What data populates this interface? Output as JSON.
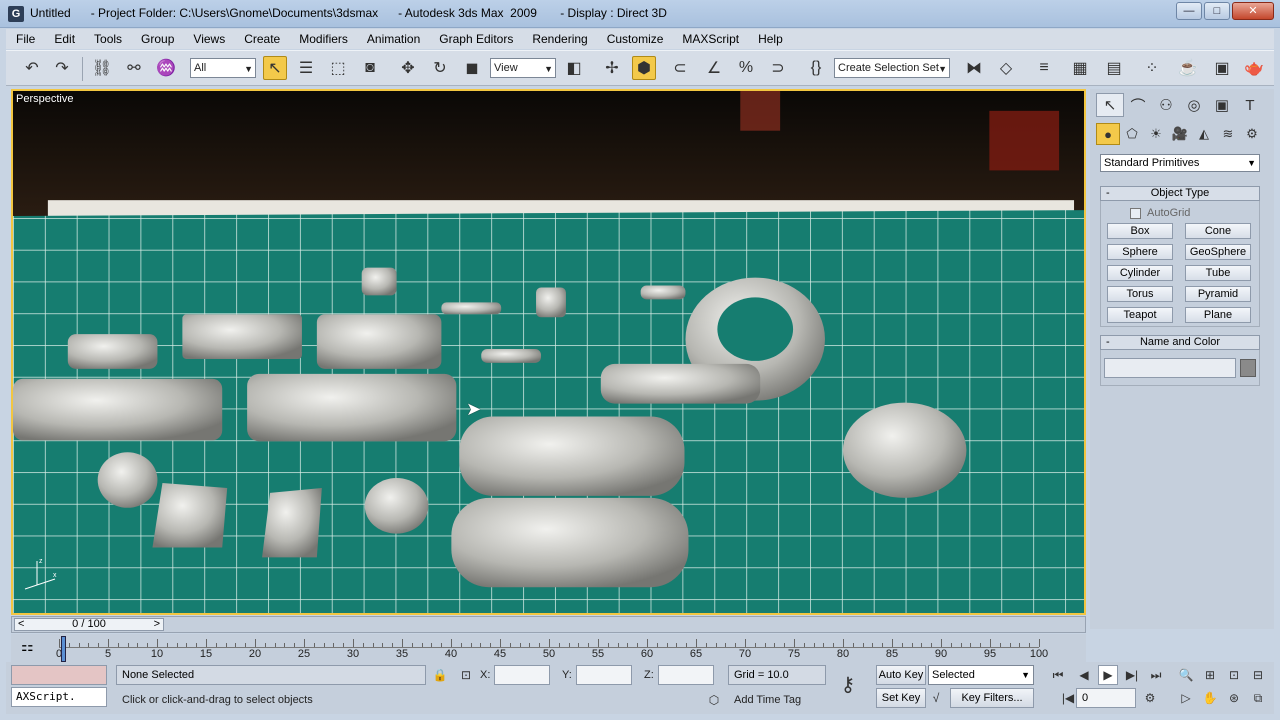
{
  "window": {
    "title": "Untitled      - Project Folder: C:\\Users\\Gnome\\Documents\\3dsmax      - Autodesk 3ds Max  2009       - Display : Direct 3D",
    "minimize": "—",
    "maximize": "□",
    "close": "✕"
  },
  "menu": [
    "File",
    "Edit",
    "Tools",
    "Group",
    "Views",
    "Create",
    "Modifiers",
    "Animation",
    "Graph Editors",
    "Rendering",
    "Customize",
    "MAXScript",
    "Help"
  ],
  "toolbar": {
    "selection_filter": "All",
    "reference_coord": "View",
    "named_selection": "Create Selection Set"
  },
  "viewport": {
    "label": "Perspective"
  },
  "command_panel": {
    "category": "Standard Primitives",
    "object_type_title": "Object Type",
    "autogrid_label": "AutoGrid",
    "primitives": [
      "Box",
      "Cone",
      "Sphere",
      "GeoSphere",
      "Cylinder",
      "Tube",
      "Torus",
      "Pyramid",
      "Teapot",
      "Plane"
    ],
    "name_color_title": "Name and Color",
    "rollout_toggle": "-"
  },
  "time_slider": {
    "frame": "0 / 100",
    "prev": "<",
    "next": ">"
  },
  "track_bar": {
    "ticks": [
      "0",
      "5",
      "10",
      "15",
      "20",
      "25",
      "30",
      "35",
      "40",
      "45",
      "50",
      "55",
      "60",
      "65",
      "70",
      "75",
      "80",
      "85",
      "90",
      "95",
      "100"
    ]
  },
  "status": {
    "maxscript": "AXScript.",
    "selection": "None Selected",
    "prompt": "Click or click-and-drag to select objects",
    "x_label": "X:",
    "y_label": "Y:",
    "z_label": "Z:",
    "grid": "Grid = 10.0",
    "add_time_tag": "Add Time Tag",
    "auto_key": "Auto Key",
    "set_key": "Set Key",
    "key_mode": "Selected",
    "key_filters": "Key Filters...",
    "current_frame": "0"
  }
}
